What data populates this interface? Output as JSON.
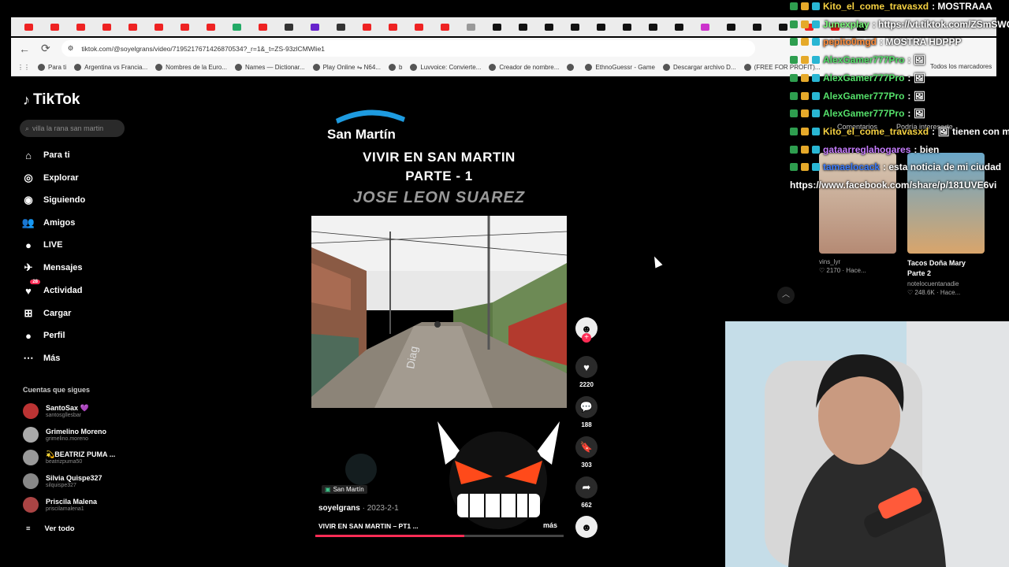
{
  "browser": {
    "url": "tiktok.com/@soyelgrans/video/7195217671426870534?_r=1&_t=ZS-93zlCMWlie1",
    "bookmarks": [
      "Para ti",
      "Argentina vs Francia...",
      "Nombres de la Euro...",
      "Names — Dictionar...",
      "Play Online ⇋ N64...",
      "b",
      "Luvvoice: Convierte...",
      "Creador de nombre...",
      "",
      "EthnoGuessr - Game",
      "Descargar archivo D...",
      "(FREE FOR PROFIT)..."
    ],
    "all_bookmarks": "Todos los marcadores"
  },
  "tiktok": {
    "logo": "TikTok",
    "search_placeholder": "villa la rana san martin",
    "nav": [
      {
        "label": "Para ti",
        "icon": "home-icon"
      },
      {
        "label": "Explorar",
        "icon": "compass-icon"
      },
      {
        "label": "Siguiendo",
        "icon": "following-icon"
      },
      {
        "label": "Amigos",
        "icon": "friends-icon"
      },
      {
        "label": "LIVE",
        "icon": "live-icon"
      },
      {
        "label": "Mensajes",
        "icon": "messages-icon"
      },
      {
        "label": "Actividad",
        "icon": "activity-icon",
        "badge": "28"
      },
      {
        "label": "Cargar",
        "icon": "upload-icon"
      },
      {
        "label": "Perfil",
        "icon": "profile-icon"
      },
      {
        "label": "Más",
        "icon": "more-icon"
      }
    ],
    "following_title": "Cuentas que sigues",
    "accounts": [
      {
        "name": "SantoSax 💜",
        "handle": "santosgllesbar"
      },
      {
        "name": "Grimelino Moreno",
        "handle": "grimelino.moreno"
      },
      {
        "name": "💫BEATRIZ PUMA ...",
        "handle": "beatrizpuma50"
      },
      {
        "name": "Silvia Quispe327",
        "handle": "silquispe327"
      },
      {
        "name": "Priscila Malena",
        "handle": "priscilamalena1"
      }
    ],
    "see_all": "Ver todo"
  },
  "video": {
    "brand": "San Martín",
    "title1": "VIVIR EN SAN MARTIN",
    "title2": "PARTE - 1",
    "title3": "JOSE LEON SUAREZ",
    "tag": "San Martín",
    "creator": "soyelgrans",
    "date": " · 2023-2-1",
    "caption": "VIVIR EN SAN MARTIN – PT1 ...",
    "more": "más",
    "progress": 0.6,
    "likes": "2220",
    "comments": "188",
    "saves": "303",
    "shares": "662"
  },
  "right_panel": {
    "tabs": [
      "Comentarios",
      "Podría interesarte"
    ],
    "cards": [
      {
        "title": "",
        "name": "vins_lyr",
        "stat": "♡ 2170 · Hace..."
      },
      {
        "title": "Tacos Doña Mary Parte 2",
        "name": "notelocuentanadie",
        "stat": "♡ 248.6K · Hace..."
      }
    ]
  },
  "chat": [
    {
      "user": "Kito_el_come_travasxd",
      "msg": " : MOSTRAAA",
      "color": "#f5d142"
    },
    {
      "user": "Junexplay",
      "msg": " : https://vt.tiktok.com/ZSmSWQ",
      "color": "#7cfc7c"
    },
    {
      "user": "pepito0mgd",
      "msg": " : MOSTRA HDPPP",
      "color": "#ff8c3a"
    },
    {
      "user": "AlexGamer777Pro",
      "msg": " : 🖼",
      "color": "#55e06a"
    },
    {
      "user": "AlexGamer777Pro",
      "msg": " : 🖼",
      "color": "#55e06a"
    },
    {
      "user": "AlexGamer777Pro",
      "msg": " : 🖼",
      "color": "#55e06a"
    },
    {
      "user": "AlexGamer777Pro",
      "msg": " : 🖼",
      "color": "#55e06a"
    },
    {
      "user": "Kito_el_come_travasxd",
      "msg": " : 🖼 tienen con mi",
      "color": "#f5d142"
    },
    {
      "user": "gataarreglahogares",
      "msg": " : bien",
      "color": "#c77dff"
    },
    {
      "user": "tamaelocack",
      "msg": " : esta noticia de mi ciudad",
      "color": "#3a7bff"
    },
    {
      "user": "",
      "msg": "https://www.facebook.com/share/p/181UVE6vi",
      "color": "#ffffff"
    }
  ]
}
